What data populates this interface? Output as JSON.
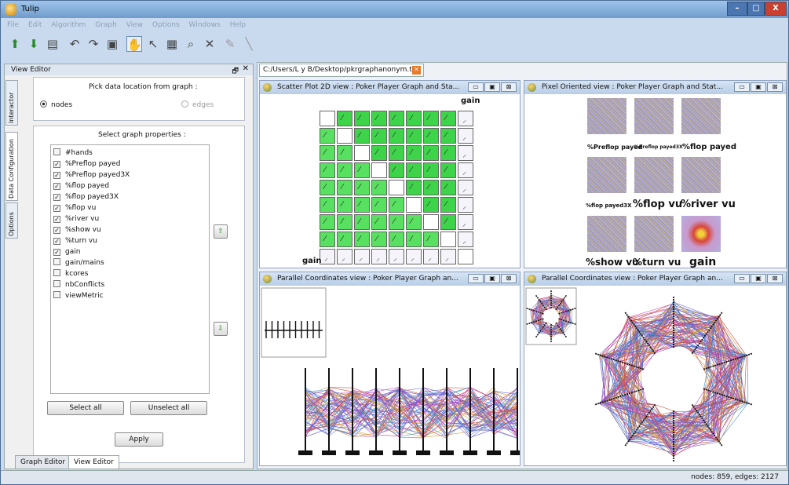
{
  "window": {
    "title": "Tulip",
    "controls": [
      "–",
      "□",
      "X"
    ]
  },
  "menu": [
    "File",
    "Edit",
    "Algorithm",
    "Graph",
    "View",
    "Options",
    "Windows",
    "Help"
  ],
  "left_panel": {
    "title": "View Editor",
    "vertical_tabs": [
      "Interactor",
      "Data Configuration",
      "Options"
    ],
    "pick_label": "Pick data location from graph :",
    "radio_nodes": "nodes",
    "radio_edges": "edges",
    "select_label": "Select graph properties :",
    "properties": [
      {
        "name": "#hands",
        "checked": false
      },
      {
        "name": "%Preflop payed",
        "checked": true
      },
      {
        "name": "%Preflop payed3X",
        "checked": true
      },
      {
        "name": "%flop payed",
        "checked": true
      },
      {
        "name": "%flop payed3X",
        "checked": true
      },
      {
        "name": "%flop vu",
        "checked": true
      },
      {
        "name": "%river vu",
        "checked": true
      },
      {
        "name": "%show vu",
        "checked": true
      },
      {
        "name": "%turn vu",
        "checked": true
      },
      {
        "name": "gain",
        "checked": true
      },
      {
        "name": "gain/mains",
        "checked": false
      },
      {
        "name": "kcores",
        "checked": false
      },
      {
        "name": "nbConflicts",
        "checked": false
      },
      {
        "name": "viewMetric",
        "checked": false
      }
    ],
    "select_all": "Select all",
    "unselect_all": "Unselect all",
    "apply": "Apply",
    "bottom_tabs": [
      "Graph Editor",
      "View Editor"
    ]
  },
  "main": {
    "file_tab": "C:/Users/L y B/Desktop/pkrgraphanonym.tlp",
    "views": [
      {
        "title": "Scatter Plot 2D view : Poker Player Graph and Sta..."
      },
      {
        "title": "Pixel Oriented view : Poker Player Graph and Stat..."
      },
      {
        "title": "Parallel Coordinates view : Poker Player Graph an..."
      },
      {
        "title": "Parallel Coordinates view : Poker Player Graph an..."
      }
    ],
    "scatter_gain_label": "gain",
    "pixel_labels": [
      "%Preflop payed",
      "%Preflop payed3X",
      "%flop payed",
      "%flop payed3X",
      "%flop vu",
      "%river vu",
      "%show vu",
      "%turn vu",
      "gain"
    ]
  },
  "status": "nodes: 859, edges: 2127"
}
